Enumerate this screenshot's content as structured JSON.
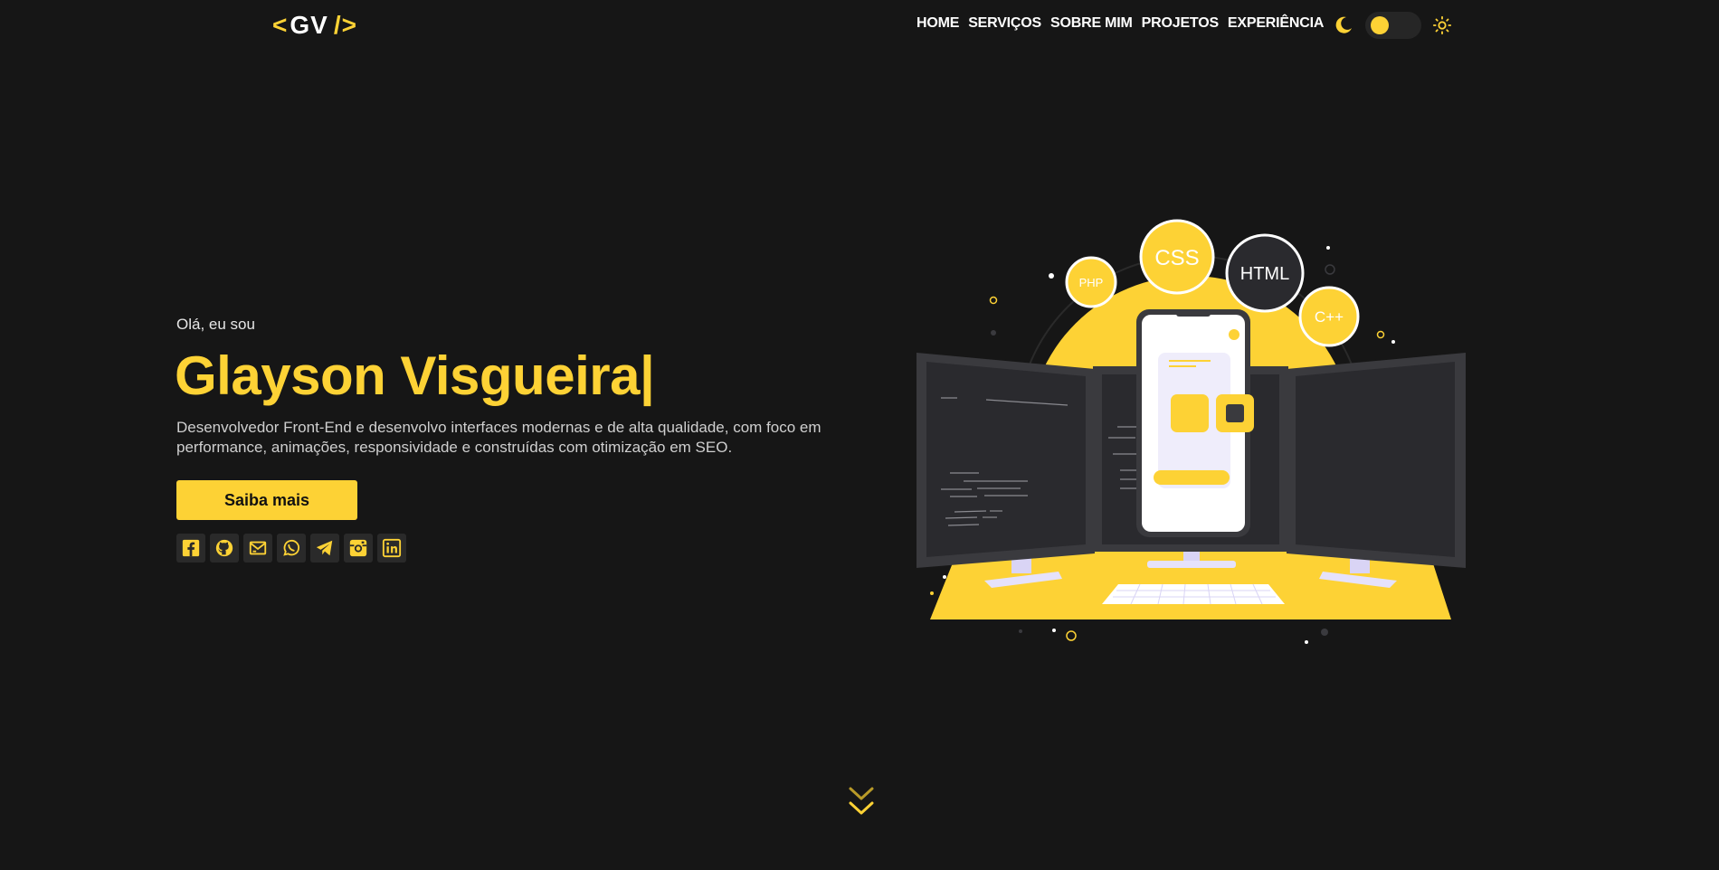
{
  "logo": {
    "open": "<",
    "initials": "GV",
    "close": "/>"
  },
  "nav": [
    "HOME",
    "SERVIÇOS",
    "SOBRE MIM",
    "PROJETOS",
    "EXPERIÊNCIA"
  ],
  "theme": {
    "moon_icon": "moon-icon",
    "sun_icon": "sun-icon",
    "mode": "dark"
  },
  "hero": {
    "greeting": "Olá, eu sou",
    "name": "Glayson Visgueira|",
    "description": "Desenvolvedor Front-End e desenvolvo interfaces modernas e de alta qualidade, com foco em performance, animações, responsividade e construídas com otimização em SEO.",
    "cta_label": "Saiba mais"
  },
  "socials": [
    "facebook-icon",
    "github-icon",
    "email-icon",
    "whatsapp-icon",
    "telegram-icon",
    "instagram-icon",
    "linkedin-icon"
  ],
  "illustration": {
    "badges": [
      "PHP",
      "CSS",
      "HTML",
      "C++"
    ]
  },
  "colors": {
    "accent": "#fdd235",
    "background": "#161616",
    "panel": "#2a2a2a"
  }
}
